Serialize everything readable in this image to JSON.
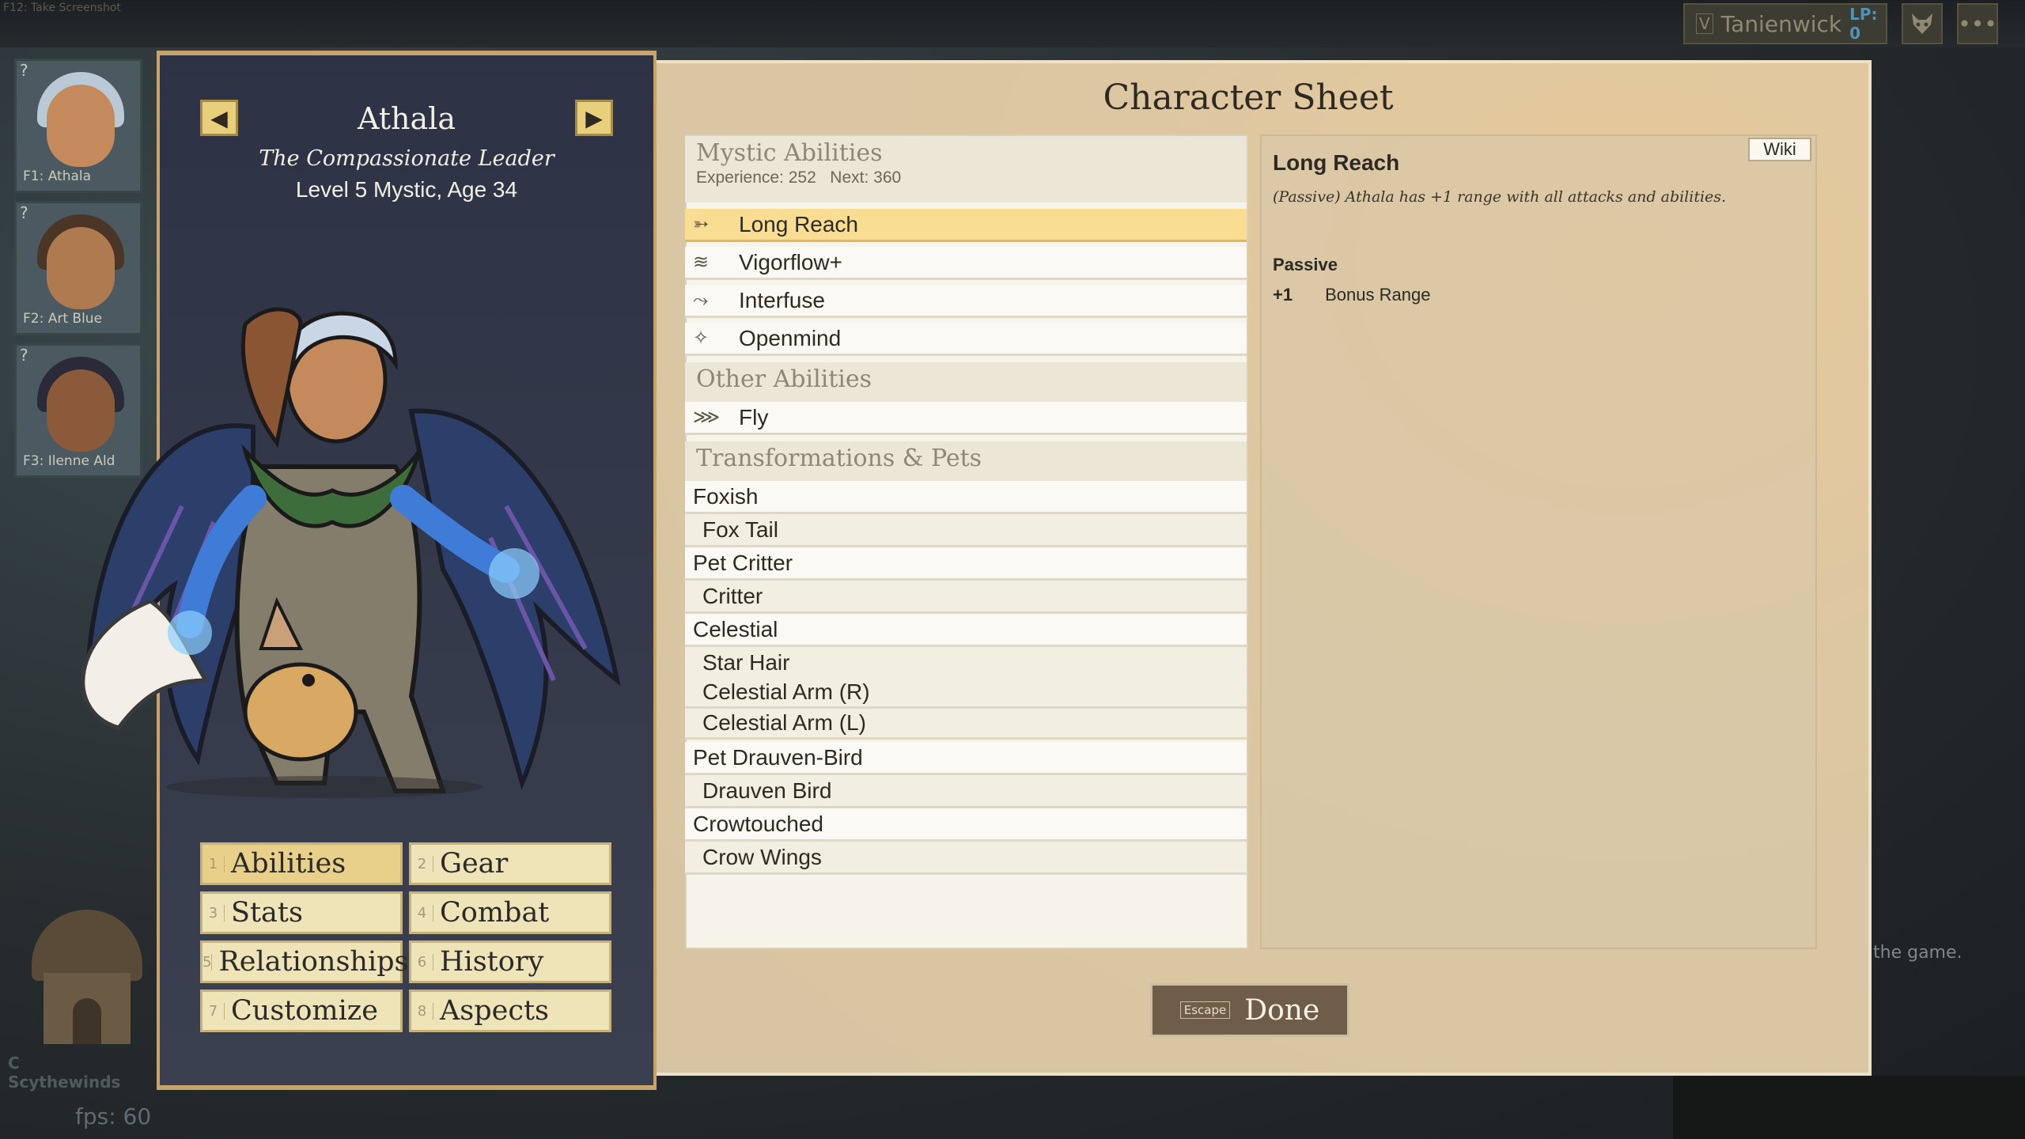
{
  "system": {
    "screenshot_hint": "F12: Take Screenshot",
    "fps": "fps: 60",
    "background_hint": "the game.",
    "location_key": "C",
    "location_name": "Scythewinds"
  },
  "topbar": {
    "player_key": "V",
    "player_name": "Tanienwick",
    "lp": "LP: 0",
    "avatar_icon": "fox-mask-icon",
    "menu_icon": "ellipsis-icon",
    "menu_glyph": "•••"
  },
  "party": [
    {
      "label": "F1: Athala",
      "q": "?",
      "skin": "#c58a5c",
      "hair": "#b9c9d6"
    },
    {
      "label": "F2: Art Blue",
      "q": "?",
      "skin": "#b07a50",
      "hair": "#4a3526"
    },
    {
      "label": "F3: Ilenne Ald",
      "q": "?",
      "skin": "#8a5a3a",
      "hair": "#2a2a38"
    }
  ],
  "character": {
    "prev_icon": "◀",
    "next_icon": "▶",
    "name": "Athala",
    "title": "The Compassionate Leader",
    "level": "Level 5 Mystic, Age 34"
  },
  "tabs": [
    {
      "key": "1",
      "label": "Abilities",
      "active": true
    },
    {
      "key": "2",
      "label": "Gear",
      "active": false
    },
    {
      "key": "3",
      "label": "Stats",
      "active": false
    },
    {
      "key": "4",
      "label": "Combat",
      "active": false
    },
    {
      "key": "5",
      "label": "Relationships",
      "active": false
    },
    {
      "key": "6",
      "label": "History",
      "active": false
    },
    {
      "key": "7",
      "label": "Customize",
      "active": false
    },
    {
      "key": "8",
      "label": "Aspects",
      "active": false
    }
  ],
  "sheet": {
    "title": "Character Sheet",
    "mystic_header": "Mystic Abilities",
    "experience": "Experience: 252",
    "next": "Next: 360",
    "mystic_abilities": [
      {
        "label": "Long Reach",
        "icon": "long-reach-icon",
        "glyph": "➳",
        "selected": true
      },
      {
        "label": "Vigorflow+",
        "icon": "vigorflow-icon",
        "glyph": "≋",
        "selected": false
      },
      {
        "label": "Interfuse",
        "icon": "interfuse-icon",
        "glyph": "⤳",
        "selected": false
      },
      {
        "label": "Openmind",
        "icon": "openmind-icon",
        "glyph": "✧",
        "selected": false
      }
    ],
    "other_header": "Other Abilities",
    "other_abilities": [
      {
        "label": "Fly",
        "icon": "wing-icon",
        "glyph": "⋙"
      }
    ],
    "transform_header": "Transformations & Pets",
    "transformations": [
      {
        "label": "Foxish",
        "level": "top"
      },
      {
        "label": "Fox Tail",
        "level": "sub"
      },
      {
        "label": "Pet Critter",
        "level": "top"
      },
      {
        "label": "Critter",
        "level": "sub"
      },
      {
        "label": "Celestial",
        "level": "top"
      },
      {
        "label": "Star Hair",
        "level": "sub"
      },
      {
        "label": "Celestial Arm (R)",
        "level": "sub"
      },
      {
        "label": "Celestial Arm (L)",
        "level": "sub"
      },
      {
        "label": "Pet Drauven-Bird",
        "level": "top"
      },
      {
        "label": "Drauven Bird",
        "level": "sub"
      },
      {
        "label": "Crowtouched",
        "level": "top"
      },
      {
        "label": "Crow Wings",
        "level": "sub"
      }
    ]
  },
  "detail": {
    "wiki": "Wiki",
    "title": "Long Reach",
    "description": "(Passive) Athala has +1 range with all attacks and abilities.",
    "type": "Passive",
    "stat_value": "+1",
    "stat_name": "Bonus Range"
  },
  "done": {
    "key": "Escape",
    "label": "Done"
  }
}
